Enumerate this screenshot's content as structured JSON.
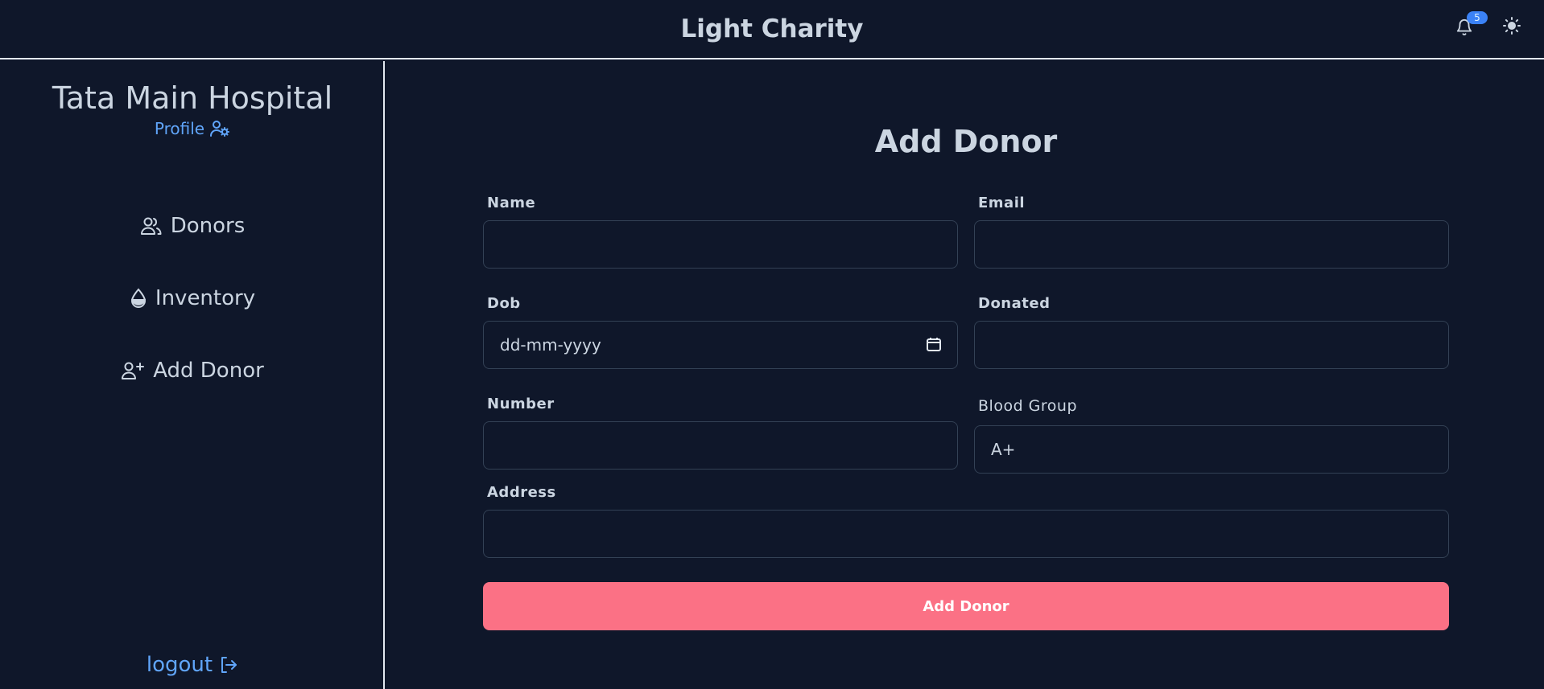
{
  "header": {
    "title": "Light Charity",
    "notification_count": "5"
  },
  "sidebar": {
    "hospital_name": "Tata Main Hospital",
    "profile_label": "Profile",
    "items": [
      {
        "label": "Donors",
        "icon": "users-icon"
      },
      {
        "label": "Inventory",
        "icon": "blood-drop-icon"
      },
      {
        "label": "Add Donor",
        "icon": "user-plus-icon"
      }
    ],
    "logout_label": "logout"
  },
  "form": {
    "title": "Add Donor",
    "name_label": "Name",
    "email_label": "Email",
    "dob_label": "Dob",
    "dob_placeholder": "dd-mm-yyyy",
    "donated_label": "Donated",
    "number_label": "Number",
    "blood_group_label": "Blood Group",
    "blood_group_value": "A+",
    "address_label": "Address",
    "submit_label": "Add Donor"
  },
  "colors": {
    "background": "#0f172a",
    "text": "#cbd5e1",
    "link": "#60a5fa",
    "accent_button": "#fb7185",
    "badge": "#3b82f6"
  }
}
